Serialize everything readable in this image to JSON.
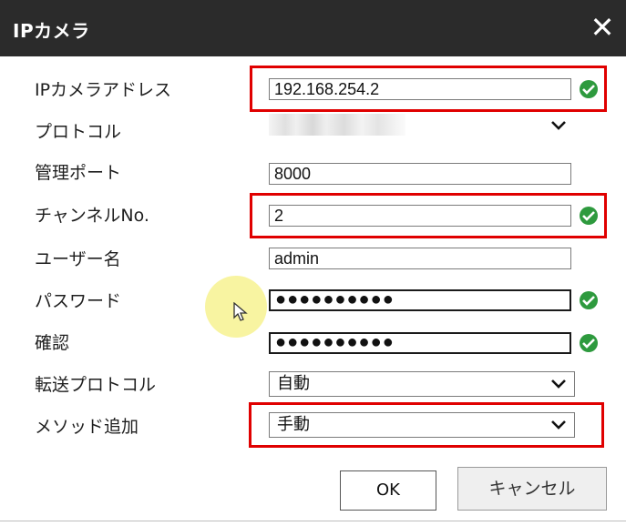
{
  "dialog": {
    "title": "IPカメラ",
    "close_icon": "close-icon"
  },
  "fields": {
    "ip_address": {
      "label": "IPカメラアドレス",
      "value": "192.168.254.2"
    },
    "protocol": {
      "label": "プロトコル"
    },
    "mgmt_port": {
      "label": "管理ポート",
      "value": "8000"
    },
    "channel_no": {
      "label": "チャンネルNo.",
      "value": "2"
    },
    "username": {
      "label": "ユーザー名",
      "value": "admin"
    },
    "password": {
      "label": "パスワード",
      "value": "●●●●●●●●●●"
    },
    "confirm": {
      "label": "確認",
      "value": "●●●●●●●●●●"
    },
    "transport_protocol": {
      "label": "転送プロトコル",
      "value": "自動"
    },
    "add_method": {
      "label": "メソッド追加",
      "value": "手動"
    }
  },
  "buttons": {
    "ok": "OK",
    "cancel": "キャンセル"
  },
  "colors": {
    "titlebar": "#2b2b2b",
    "highlight": "#e00000",
    "valid": "#2e9a3e"
  }
}
